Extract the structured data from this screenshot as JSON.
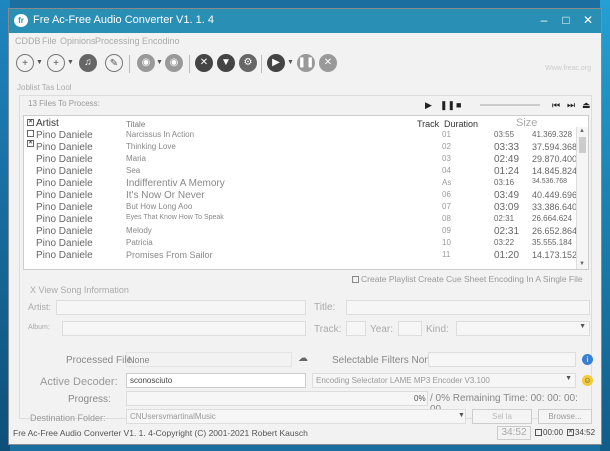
{
  "window": {
    "title": "Fre Ac-Free Audio Converter V1. 1. 4",
    "logo_text": "fr",
    "min_glyph": "–",
    "max_glyph": "□",
    "close_glyph": "✕"
  },
  "menu": [
    "CDDB",
    "File",
    "Opinions",
    "Processing",
    "Encodino"
  ],
  "toolbar": {
    "website": "Www.freac.org"
  },
  "tab": {
    "label": "Joblist Tas Lool"
  },
  "joblist": {
    "files_label": "13 Files To Process:",
    "headers": {
      "artist": "Artist",
      "title": "Titale",
      "track": "Track",
      "duration": "Duration",
      "size": "Size"
    },
    "rows": [
      {
        "artist": "Pino Daniele",
        "title": "Narcissus In Action",
        "track": "01",
        "duration": "03:55",
        "size": "41.369.328"
      },
      {
        "artist": "Pino Daniele",
        "title": "Thinking Love",
        "track": "02",
        "duration": "03:33",
        "size": "37.594.368"
      },
      {
        "artist": "Pino Daniele",
        "title": "Maria",
        "track": "03",
        "duration": "02:49",
        "size": "29.870.400"
      },
      {
        "artist": "Pino Daniele",
        "title": "Sea",
        "track": "04",
        "duration": "01:24",
        "size": "14.845.824"
      },
      {
        "artist": "Pino Daniele",
        "title": "Indifferentiv A Memory",
        "track": "As",
        "duration": "03:16",
        "size": "34.536.768"
      },
      {
        "artist": "Pino Daniele",
        "title": "It's Now Or Never",
        "track": "06",
        "duration": "03:49",
        "size": "40.449.696"
      },
      {
        "artist": "Pino Daniele",
        "title": "But How Long Aoo",
        "track": "07",
        "duration": "03:09",
        "size": "33.386.640"
      },
      {
        "artist": "Pino Daniele",
        "title": "Eyes That Know How To Speak",
        "track": "08",
        "duration": "02:31",
        "size": "26.664.624"
      },
      {
        "artist": "Pino Daniele",
        "title": "Melody",
        "track": "09",
        "duration": "02:31",
        "size": "26.652.864"
      },
      {
        "artist": "Pino Daniele",
        "title": "Patricia",
        "track": "10",
        "duration": "03:22",
        "size": "35.555.184"
      },
      {
        "artist": "Pino Daniele",
        "title": "Promises From Sailor",
        "track": "11",
        "duration": "01:20",
        "size": "14.173.152"
      }
    ],
    "cue_label": "Create Playlist Create Cue Sheet Encoding In A Single File"
  },
  "song_info": {
    "heading": "X View Song Information",
    "artist_label": "Artist:",
    "title_label": "Title:",
    "album_label": "Album:",
    "track_label": "Track:",
    "year_label": "Year:",
    "kind_label": "Kind:"
  },
  "processing": {
    "processed_file_label": "Processed File:",
    "processed_file_value": "None",
    "filters_label": "Selectable Filters None",
    "decoder_label": "Active Decoder:",
    "decoder_value": "sconosciuto",
    "encoder_value": "Encoding Selectator LAME MP3 Encoder V3.100",
    "progress_label": "Progress:",
    "progress_pct": "0%",
    "remaining": "/ 0% Remaining Time: 00: 00: 00: 00",
    "destination_label": "Destination Folder:",
    "destination_value": "CNUsersvmartinalMusic",
    "select_button": "Sel la",
    "browse_button": "Browse..."
  },
  "status": {
    "copyright": "Fre Ac-Free Audio Converter V1. 1. 4-Copyright (C) 2001-2021 Robert Kausch",
    "clock": "34:52",
    "box1": "00:00",
    "box2": "34:52"
  },
  "colors": {
    "titlebar": "#2a8fb4",
    "window_bg": "#f2f2f2"
  }
}
